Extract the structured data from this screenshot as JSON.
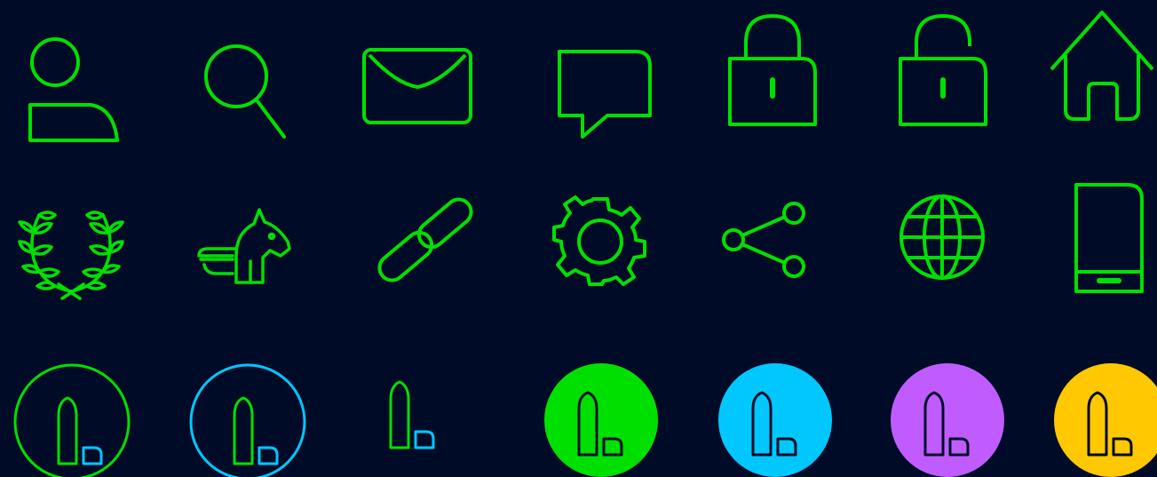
{
  "palette": {
    "background": "#000b28",
    "green": "#00e000",
    "blue": "#00c8ff",
    "purple": "#c05cff",
    "yellow": "#ffc800"
  },
  "rows": [
    {
      "icons": [
        "user-icon",
        "search-icon",
        "mail-icon",
        "chat-bubble-icon",
        "lock-icon",
        "unlock-icon",
        "home-icon"
      ]
    },
    {
      "icons": [
        "laurel-wreath-icon",
        "pegasus-icon",
        "link-icon",
        "gear-icon",
        "share-icon",
        "globe-icon",
        "smartphone-icon"
      ]
    },
    {
      "icons": [
        "logo-outline-green-circle",
        "logo-outline-blue-circle",
        "logo-mark-plain",
        "logo-badge-green",
        "logo-badge-blue",
        "logo-badge-purple",
        "logo-badge-yellow"
      ]
    }
  ]
}
